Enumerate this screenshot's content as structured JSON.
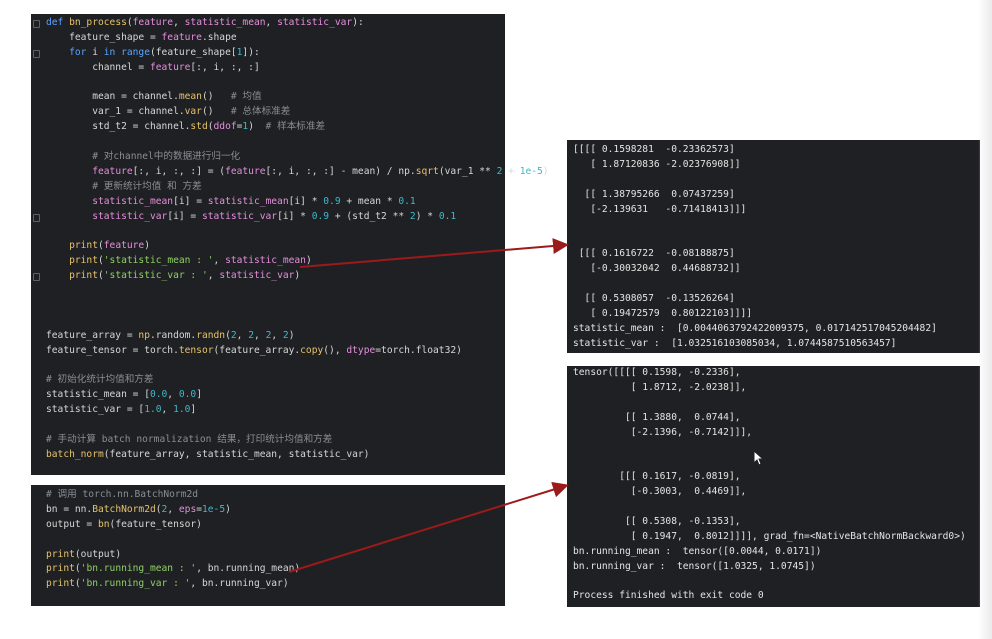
{
  "editor_top": {
    "lines": [
      [
        {
          "t": "def ",
          "c": "kw"
        },
        {
          "t": "bn_process",
          "c": "fn"
        },
        {
          "t": "(",
          "c": ""
        },
        {
          "t": "feature",
          "c": "param"
        },
        {
          "t": ", ",
          "c": ""
        },
        {
          "t": "statistic_mean",
          "c": "param"
        },
        {
          "t": ", ",
          "c": ""
        },
        {
          "t": "statistic_var",
          "c": "param"
        },
        {
          "t": "):",
          "c": ""
        }
      ],
      [
        {
          "t": "    feature_shape = ",
          "c": ""
        },
        {
          "t": "feature",
          "c": "param"
        },
        {
          "t": ".shape",
          "c": ""
        }
      ],
      [
        {
          "t": "    ",
          "c": ""
        },
        {
          "t": "for ",
          "c": "kw"
        },
        {
          "t": "i ",
          "c": ""
        },
        {
          "t": "in ",
          "c": "kw"
        },
        {
          "t": "range",
          "c": "kw"
        },
        {
          "t": "(feature_shape[",
          "c": ""
        },
        {
          "t": "1",
          "c": "num"
        },
        {
          "t": "]):",
          "c": ""
        }
      ],
      [
        {
          "t": "        channel = ",
          "c": ""
        },
        {
          "t": "feature",
          "c": "param"
        },
        {
          "t": "[:, i, :, :]",
          "c": ""
        }
      ],
      [],
      [
        {
          "t": "        mean = channel.",
          "c": ""
        },
        {
          "t": "mean",
          "c": "fn"
        },
        {
          "t": "()   ",
          "c": ""
        },
        {
          "t": "# 均值",
          "c": "cm"
        }
      ],
      [
        {
          "t": "        var_1 = channel.",
          "c": ""
        },
        {
          "t": "var",
          "c": "fn"
        },
        {
          "t": "()   ",
          "c": ""
        },
        {
          "t": "# 总体标准差",
          "c": "cm"
        }
      ],
      [
        {
          "t": "        std_t2 = channel.",
          "c": ""
        },
        {
          "t": "std",
          "c": "fn"
        },
        {
          "t": "(",
          "c": ""
        },
        {
          "t": "ddof",
          "c": "param"
        },
        {
          "t": "=",
          "c": ""
        },
        {
          "t": "1",
          "c": "num"
        },
        {
          "t": ")  ",
          "c": ""
        },
        {
          "t": "# 样本标准差",
          "c": "cm"
        }
      ],
      [],
      [
        {
          "t": "        ",
          "c": ""
        },
        {
          "t": "# 对channel中的数据进行归一化",
          "c": "cm"
        }
      ],
      [
        {
          "t": "        ",
          "c": ""
        },
        {
          "t": "feature",
          "c": "param"
        },
        {
          "t": "[:, i, :, :] = (",
          "c": ""
        },
        {
          "t": "feature",
          "c": "param"
        },
        {
          "t": "[:, i, :, :] - mean) / np.",
          "c": ""
        },
        {
          "t": "sqrt",
          "c": "fn"
        },
        {
          "t": "(var_1 ** ",
          "c": ""
        },
        {
          "t": "2",
          "c": "num"
        },
        {
          "t": " + ",
          "c": ""
        },
        {
          "t": "1e-5",
          "c": "num"
        },
        {
          "t": ")",
          "c": ""
        }
      ],
      [
        {
          "t": "        ",
          "c": ""
        },
        {
          "t": "# 更新统计均值 和 方差",
          "c": "cm"
        }
      ],
      [
        {
          "t": "        ",
          "c": ""
        },
        {
          "t": "statistic_mean",
          "c": "param"
        },
        {
          "t": "[i] = ",
          "c": ""
        },
        {
          "t": "statistic_mean",
          "c": "param"
        },
        {
          "t": "[i] * ",
          "c": ""
        },
        {
          "t": "0.9",
          "c": "num"
        },
        {
          "t": " + mean * ",
          "c": ""
        },
        {
          "t": "0.1",
          "c": "num"
        }
      ],
      [
        {
          "t": "        ",
          "c": ""
        },
        {
          "t": "statistic_var",
          "c": "param"
        },
        {
          "t": "[i] = ",
          "c": ""
        },
        {
          "t": "statistic_var",
          "c": "param"
        },
        {
          "t": "[i] * ",
          "c": ""
        },
        {
          "t": "0.9",
          "c": "num"
        },
        {
          "t": " + (std_t2 ** ",
          "c": ""
        },
        {
          "t": "2",
          "c": "num"
        },
        {
          "t": ") * ",
          "c": ""
        },
        {
          "t": "0.1",
          "c": "num"
        }
      ],
      [],
      [
        {
          "t": "    ",
          "c": ""
        },
        {
          "t": "print",
          "c": "fn"
        },
        {
          "t": "(",
          "c": ""
        },
        {
          "t": "feature",
          "c": "param"
        },
        {
          "t": ")",
          "c": ""
        }
      ],
      [
        {
          "t": "    ",
          "c": ""
        },
        {
          "t": "print",
          "c": "fn"
        },
        {
          "t": "(",
          "c": ""
        },
        {
          "t": "'statistic_mean : '",
          "c": "str"
        },
        {
          "t": ", ",
          "c": ""
        },
        {
          "t": "statistic_mean",
          "c": "param"
        },
        {
          "t": ")",
          "c": ""
        }
      ],
      [
        {
          "t": "    ",
          "c": ""
        },
        {
          "t": "print",
          "c": "fn"
        },
        {
          "t": "(",
          "c": ""
        },
        {
          "t": "'statistic_var : '",
          "c": "str"
        },
        {
          "t": ", ",
          "c": ""
        },
        {
          "t": "statistic_var",
          "c": "param"
        },
        {
          "t": ")",
          "c": ""
        }
      ],
      [],
      [],
      [],
      [
        {
          "t": "feature_array = ",
          "c": ""
        },
        {
          "t": "np",
          "c": "fn"
        },
        {
          "t": ".random.",
          "c": ""
        },
        {
          "t": "randn",
          "c": "fn"
        },
        {
          "t": "(",
          "c": ""
        },
        {
          "t": "2",
          "c": "num"
        },
        {
          "t": ", ",
          "c": ""
        },
        {
          "t": "2",
          "c": "num"
        },
        {
          "t": ", ",
          "c": ""
        },
        {
          "t": "2",
          "c": "num"
        },
        {
          "t": ", ",
          "c": ""
        },
        {
          "t": "2",
          "c": "num"
        },
        {
          "t": ")",
          "c": ""
        }
      ],
      [
        {
          "t": "feature_tensor = torch.",
          "c": ""
        },
        {
          "t": "tensor",
          "c": "fn"
        },
        {
          "t": "(feature_array.",
          "c": ""
        },
        {
          "t": "copy",
          "c": "fn"
        },
        {
          "t": "(), ",
          "c": ""
        },
        {
          "t": "dtype",
          "c": "param"
        },
        {
          "t": "=torch.float32)",
          "c": ""
        }
      ],
      [],
      [
        {
          "t": "# 初始化统计均值和方差",
          "c": "cm"
        }
      ],
      [
        {
          "t": "statistic_mean = [",
          "c": ""
        },
        {
          "t": "0.0",
          "c": "num"
        },
        {
          "t": ", ",
          "c": ""
        },
        {
          "t": "0.0",
          "c": "num"
        },
        {
          "t": "]",
          "c": ""
        }
      ],
      [
        {
          "t": "statistic_var = [",
          "c": ""
        },
        {
          "t": "1.0",
          "c": "num"
        },
        {
          "t": ", ",
          "c": ""
        },
        {
          "t": "1.0",
          "c": "num"
        },
        {
          "t": "]",
          "c": ""
        }
      ],
      [],
      [
        {
          "t": "# 手动计算 batch normalization 结果，打印统计均值和方差",
          "c": "cm"
        }
      ],
      [
        {
          "t": "batch_norm",
          "c": "fn"
        },
        {
          "t": "(feature_array, statistic_mean, statistic_var)",
          "c": ""
        }
      ]
    ]
  },
  "editor_bottom": {
    "lines": [
      [
        {
          "t": "# 调用 torch.nn.BatchNorm2d",
          "c": "cm"
        }
      ],
      [
        {
          "t": "bn = nn.",
          "c": ""
        },
        {
          "t": "BatchNorm2d",
          "c": "fn"
        },
        {
          "t": "(",
          "c": ""
        },
        {
          "t": "2",
          "c": "num"
        },
        {
          "t": ", ",
          "c": ""
        },
        {
          "t": "eps",
          "c": "param"
        },
        {
          "t": "=",
          "c": ""
        },
        {
          "t": "1e-5",
          "c": "num"
        },
        {
          "t": ")",
          "c": ""
        }
      ],
      [
        {
          "t": "output = ",
          "c": ""
        },
        {
          "t": "bn",
          "c": "fn"
        },
        {
          "t": "(feature_tensor)",
          "c": ""
        }
      ],
      [],
      [
        {
          "t": "print",
          "c": "fn"
        },
        {
          "t": "(output)",
          "c": ""
        }
      ],
      [
        {
          "t": "print",
          "c": "fn"
        },
        {
          "t": "(",
          "c": ""
        },
        {
          "t": "'bn.running_mean : '",
          "c": "str"
        },
        {
          "t": ", bn.running_mean)",
          "c": ""
        }
      ],
      [
        {
          "t": "print",
          "c": "fn"
        },
        {
          "t": "(",
          "c": ""
        },
        {
          "t": "'bn.running_var : '",
          "c": "str"
        },
        {
          "t": ", bn.running_var)",
          "c": ""
        }
      ]
    ]
  },
  "output_top": {
    "lines": [
      "[[[[ 0.1598281  -0.23362573]",
      "   [ 1.87120836 -2.02376908]]",
      "",
      "  [[ 1.38795266  0.07437259]",
      "   [-2.139631   -0.71418413]]]",
      "",
      "",
      " [[[ 0.1616722  -0.08188875]",
      "   [-0.30032042  0.44688732]]",
      "",
      "  [[ 0.5308057  -0.13526264]",
      "   [ 0.19472579  0.80122103]]]]",
      "statistic_mean :  [0.0044063792422009375, 0.017142517045204482]",
      "statistic_var :  [1.032516103085034, 1.0744587510563457]"
    ]
  },
  "output_bottom": {
    "lines": [
      "tensor([[[[ 0.1598, -0.2336],",
      "          [ 1.8712, -2.0238]],",
      "",
      "         [[ 1.3880,  0.0744],",
      "          [-2.1396, -0.7142]]],",
      "",
      "",
      "        [[[ 0.1617, -0.0819],",
      "          [-0.3003,  0.4469]],",
      "",
      "         [[ 0.5308, -0.1353],",
      "          [ 0.1947,  0.8012]]]], grad_fn=<NativeBatchNormBackward0>)",
      "bn.running_mean :  tensor([0.0044, 0.0171])",
      "bn.running_var :  tensor([1.0325, 1.0745])",
      "",
      "Process finished with exit code 0"
    ]
  },
  "colors": {
    "panel_bg": "#1f2023",
    "arrow": "#9b1a1a",
    "keyword": "#5aa3ff",
    "function": "#e6c26a",
    "parameter": "#e38edb",
    "number": "#3fb8c9",
    "string": "#8fd065",
    "comment": "#8a8d94"
  },
  "icons": {
    "cursor": "mouse-pointer-icon",
    "fold_marker": "fold-marker-icon",
    "arrow": "red-arrow-icon"
  }
}
